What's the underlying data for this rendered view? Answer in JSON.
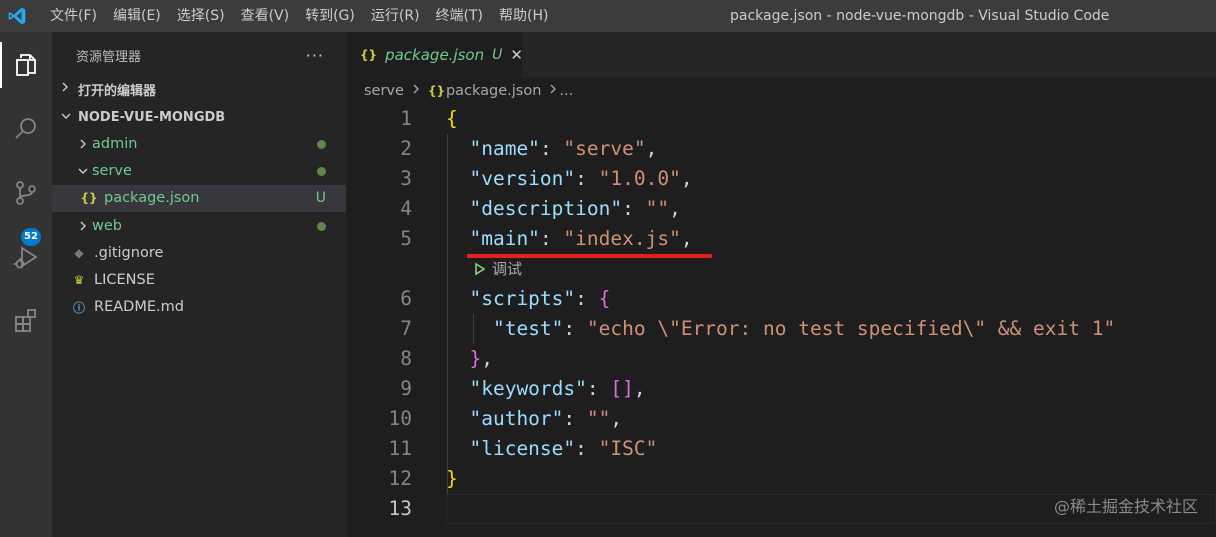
{
  "titlebar": {
    "menu": [
      "文件(F)",
      "编辑(E)",
      "选择(S)",
      "查看(V)",
      "转到(G)",
      "运行(R)",
      "终端(T)",
      "帮助(H)"
    ],
    "window_title": "package.json - node-vue-mongdb - Visual Studio Code"
  },
  "activitybar": {
    "icons": [
      "explorer-icon",
      "search-icon",
      "source-control-icon",
      "run-debug-icon",
      "extensions-icon"
    ],
    "scm_badge": "52",
    "accent": "#007acc"
  },
  "sidebar": {
    "title": "资源管理器",
    "more": "···",
    "open_editors": "打开的编辑器",
    "project": "NODE-VUE-MONGDB",
    "items": [
      {
        "label": "admin",
        "type": "folder"
      },
      {
        "label": "serve",
        "type": "folder"
      },
      {
        "label": "package.json",
        "type": "json-file",
        "status": "U"
      },
      {
        "label": "web",
        "type": "folder"
      },
      {
        "label": ".gitignore",
        "type": "git-file"
      },
      {
        "label": "LICENSE",
        "type": "license-file"
      },
      {
        "label": "README.md",
        "type": "info-file"
      }
    ]
  },
  "editor": {
    "tab": {
      "glyph": "{}",
      "label": "package.json",
      "status": "U",
      "close": "✕"
    },
    "breadcrumb": {
      "folder": "serve",
      "glyph": "{}",
      "file": "package.json",
      "more": "..."
    },
    "codelens": "调试",
    "line_numbers": [
      "1",
      "2",
      "3",
      "4",
      "5",
      "6",
      "7",
      "8",
      "9",
      "10",
      "11",
      "12",
      "13"
    ],
    "code": {
      "l1": "{",
      "l2k": "\"name\"",
      "l2v": "\"serve\"",
      "l3k": "\"version\"",
      "l3v": "\"1.0.0\"",
      "l4k": "\"description\"",
      "l4v": "\"\"",
      "l5k": "\"main\"",
      "l5v": "\"index.js\"",
      "l6k": "\"scripts\"",
      "l6b": "{",
      "l7k": "\"test\"",
      "l7v": "\"echo \\\"Error: no test specified\\\" && exit 1\"",
      "l8": "}",
      "l9k": "\"keywords\"",
      "l9v": "[]",
      "l10k": "\"author\"",
      "l10v": "\"\"",
      "l11k": "\"license\"",
      "l11v": "\"ISC\"",
      "l12": "}"
    }
  },
  "watermark": "@稀土掘金技术社区"
}
